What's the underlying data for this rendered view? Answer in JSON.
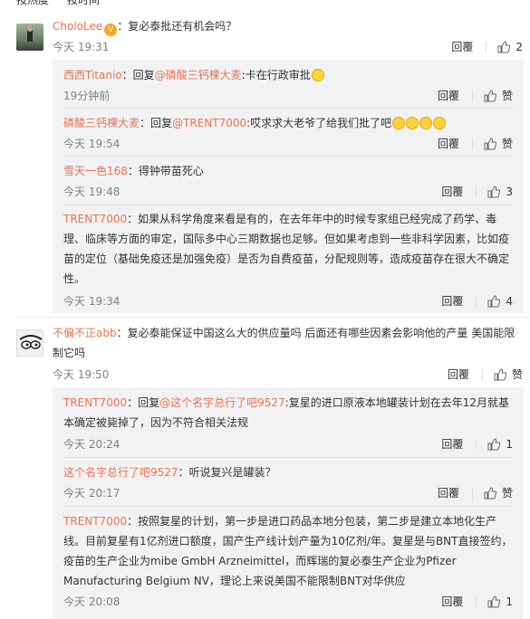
{
  "tabs": {
    "hot": "按热度",
    "time": "按时间"
  },
  "icons": {
    "like": "thumbs-up-icon"
  },
  "comments": [
    {
      "user": "CholoLee",
      "text": "：复必泰批还有机会吗？",
      "time": "今天 19:31",
      "reply_label": "回覆",
      "likes": "2",
      "replies": [
        {
          "user": "西西Titanio",
          "prefix": "：回复",
          "mention": "@磷酸三钙棵大麦",
          "text": ":卡在行政审批",
          "time": "19分钟前",
          "reply_label": "回覆",
          "likes": "赞"
        },
        {
          "user": "磷酸三钙棵大麦",
          "prefix": "：回复",
          "mention": "@TRENT7000",
          "text": ":哎求求大老爷了给我们批了吧",
          "time": "今天 19:54",
          "reply_label": "回覆",
          "likes": "赞"
        },
        {
          "user": "雪天一色168",
          "prefix": "",
          "mention": "",
          "text": "：得钟带苗死心",
          "time": "今天 19:48",
          "reply_label": "回覆",
          "likes": "3"
        },
        {
          "user": "TRENT7000",
          "prefix": "",
          "mention": "",
          "text": "：如果从科学角度来看是有的，在去年年中的时候专家组已经完成了药学、毒理、临床等方面的审定，国际多中心三期数据也足够。但如果考虑到一些非科学因素，比如疫苗的定位（基础免疫还是加强免疫）是否为自费疫苗，分配规则等，造成疫苗存在很大不确定性。",
          "time": "今天 19:34",
          "reply_label": "回覆",
          "likes": "4"
        }
      ]
    },
    {
      "user": "不偏不正abb",
      "text": "：复必泰能保证中国这么大的供应量吗 后面还有哪些因素会影响他的产量 美国能限制它吗",
      "time": "今天 19:50",
      "reply_label": "回覆",
      "likes": "赞",
      "replies": [
        {
          "user": "TRENT7000",
          "prefix": "：回复",
          "mention": "@这个名字总行了吧9527",
          "text": ":复星的进口原液本地罐装计划在去年12月就基本确定被毙掉了，因为不符合相关法规",
          "time": "今天 20:24",
          "reply_label": "回覆",
          "likes": "1"
        },
        {
          "user": "这个名字总行了吧9527",
          "prefix": "",
          "mention": "",
          "text": "：听说复兴是罐装？",
          "time": "今天 20:17",
          "reply_label": "回覆",
          "likes": "赞"
        },
        {
          "user": "TRENT7000",
          "prefix": "",
          "mention": "",
          "text": "：按照复星的计划，第一步是进口药品本地分包装，第二步是建立本地化生产线。目前复星有1亿剂进口额度，国产生产线计划产量为10亿剂/年。复星是与BNT直接签约，疫苗的生产企业为mibe GmbH Arzneimittel，而辉瑞的复必泰生产企业为Pfizer Manufacturing Belgium NV，理论上来说美国不能限制BNT对华供应",
          "time": "今天 20:08",
          "reply_label": "回覆",
          "likes": "1"
        }
      ]
    }
  ]
}
